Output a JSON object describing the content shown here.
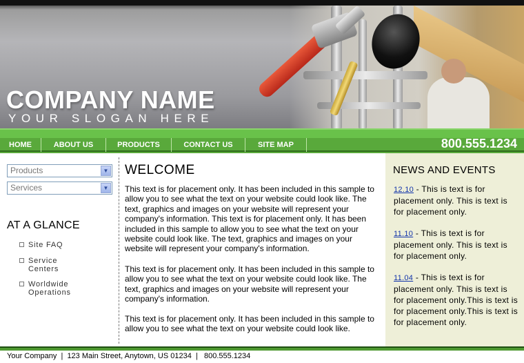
{
  "header": {
    "company_name": "COMPANY NAME",
    "slogan": "YOUR SLOGAN HERE"
  },
  "nav": {
    "items": [
      {
        "label": "HOME"
      },
      {
        "label": "ABOUT US"
      },
      {
        "label": "PRODUCTS"
      },
      {
        "label": "CONTACT US"
      },
      {
        "label": "SITE MAP"
      }
    ],
    "phone": "800.555.1234"
  },
  "sidebar": {
    "select_products": "Products",
    "select_services": "Services",
    "glance_title": "AT A GLANCE",
    "glance_items": [
      {
        "label": "Site FAQ"
      },
      {
        "label": "Service\nCenters"
      },
      {
        "label": "Worldwide\nOperations"
      }
    ]
  },
  "main": {
    "title": "WELCOME",
    "paragraphs": [
      "This text is for placement only. It has been included in this sample to allow you to see what the text on your website could look like. The text, graphics and images on your website will represent your company's information. This text is for placement only. It has been included in this sample to allow you to see what the text on your website could look like. The text, graphics and images on your website will represent your company's information.",
      "This text is for placement only. It has been included in this sample to allow you to see what the text on your website could look like. The text, graphics and images on your website will represent your company's information.",
      "This text is for placement only. It has been included in this sample to allow you to see what the text on your website could look like."
    ]
  },
  "news": {
    "title": "NEWS AND EVENTS",
    "items": [
      {
        "date": "12.10",
        "text": " - This is text is for placement only. This is text is for placement only."
      },
      {
        "date": "11.10",
        "text": " - This is text is for placement only. This is text is for placement only."
      },
      {
        "date": "11.04",
        "text": " - This is text is for placement only. This is text is for placement only.This is text is for placement only.This is text is for placement only."
      }
    ]
  },
  "footer": {
    "text": "Your Company  |  123 Main Street, Anytown, US 01234  |   800.555.1234"
  },
  "colors": {
    "nav_green": "#59a93b",
    "news_bg": "#eeefd8",
    "link_blue": "#1133aa"
  }
}
